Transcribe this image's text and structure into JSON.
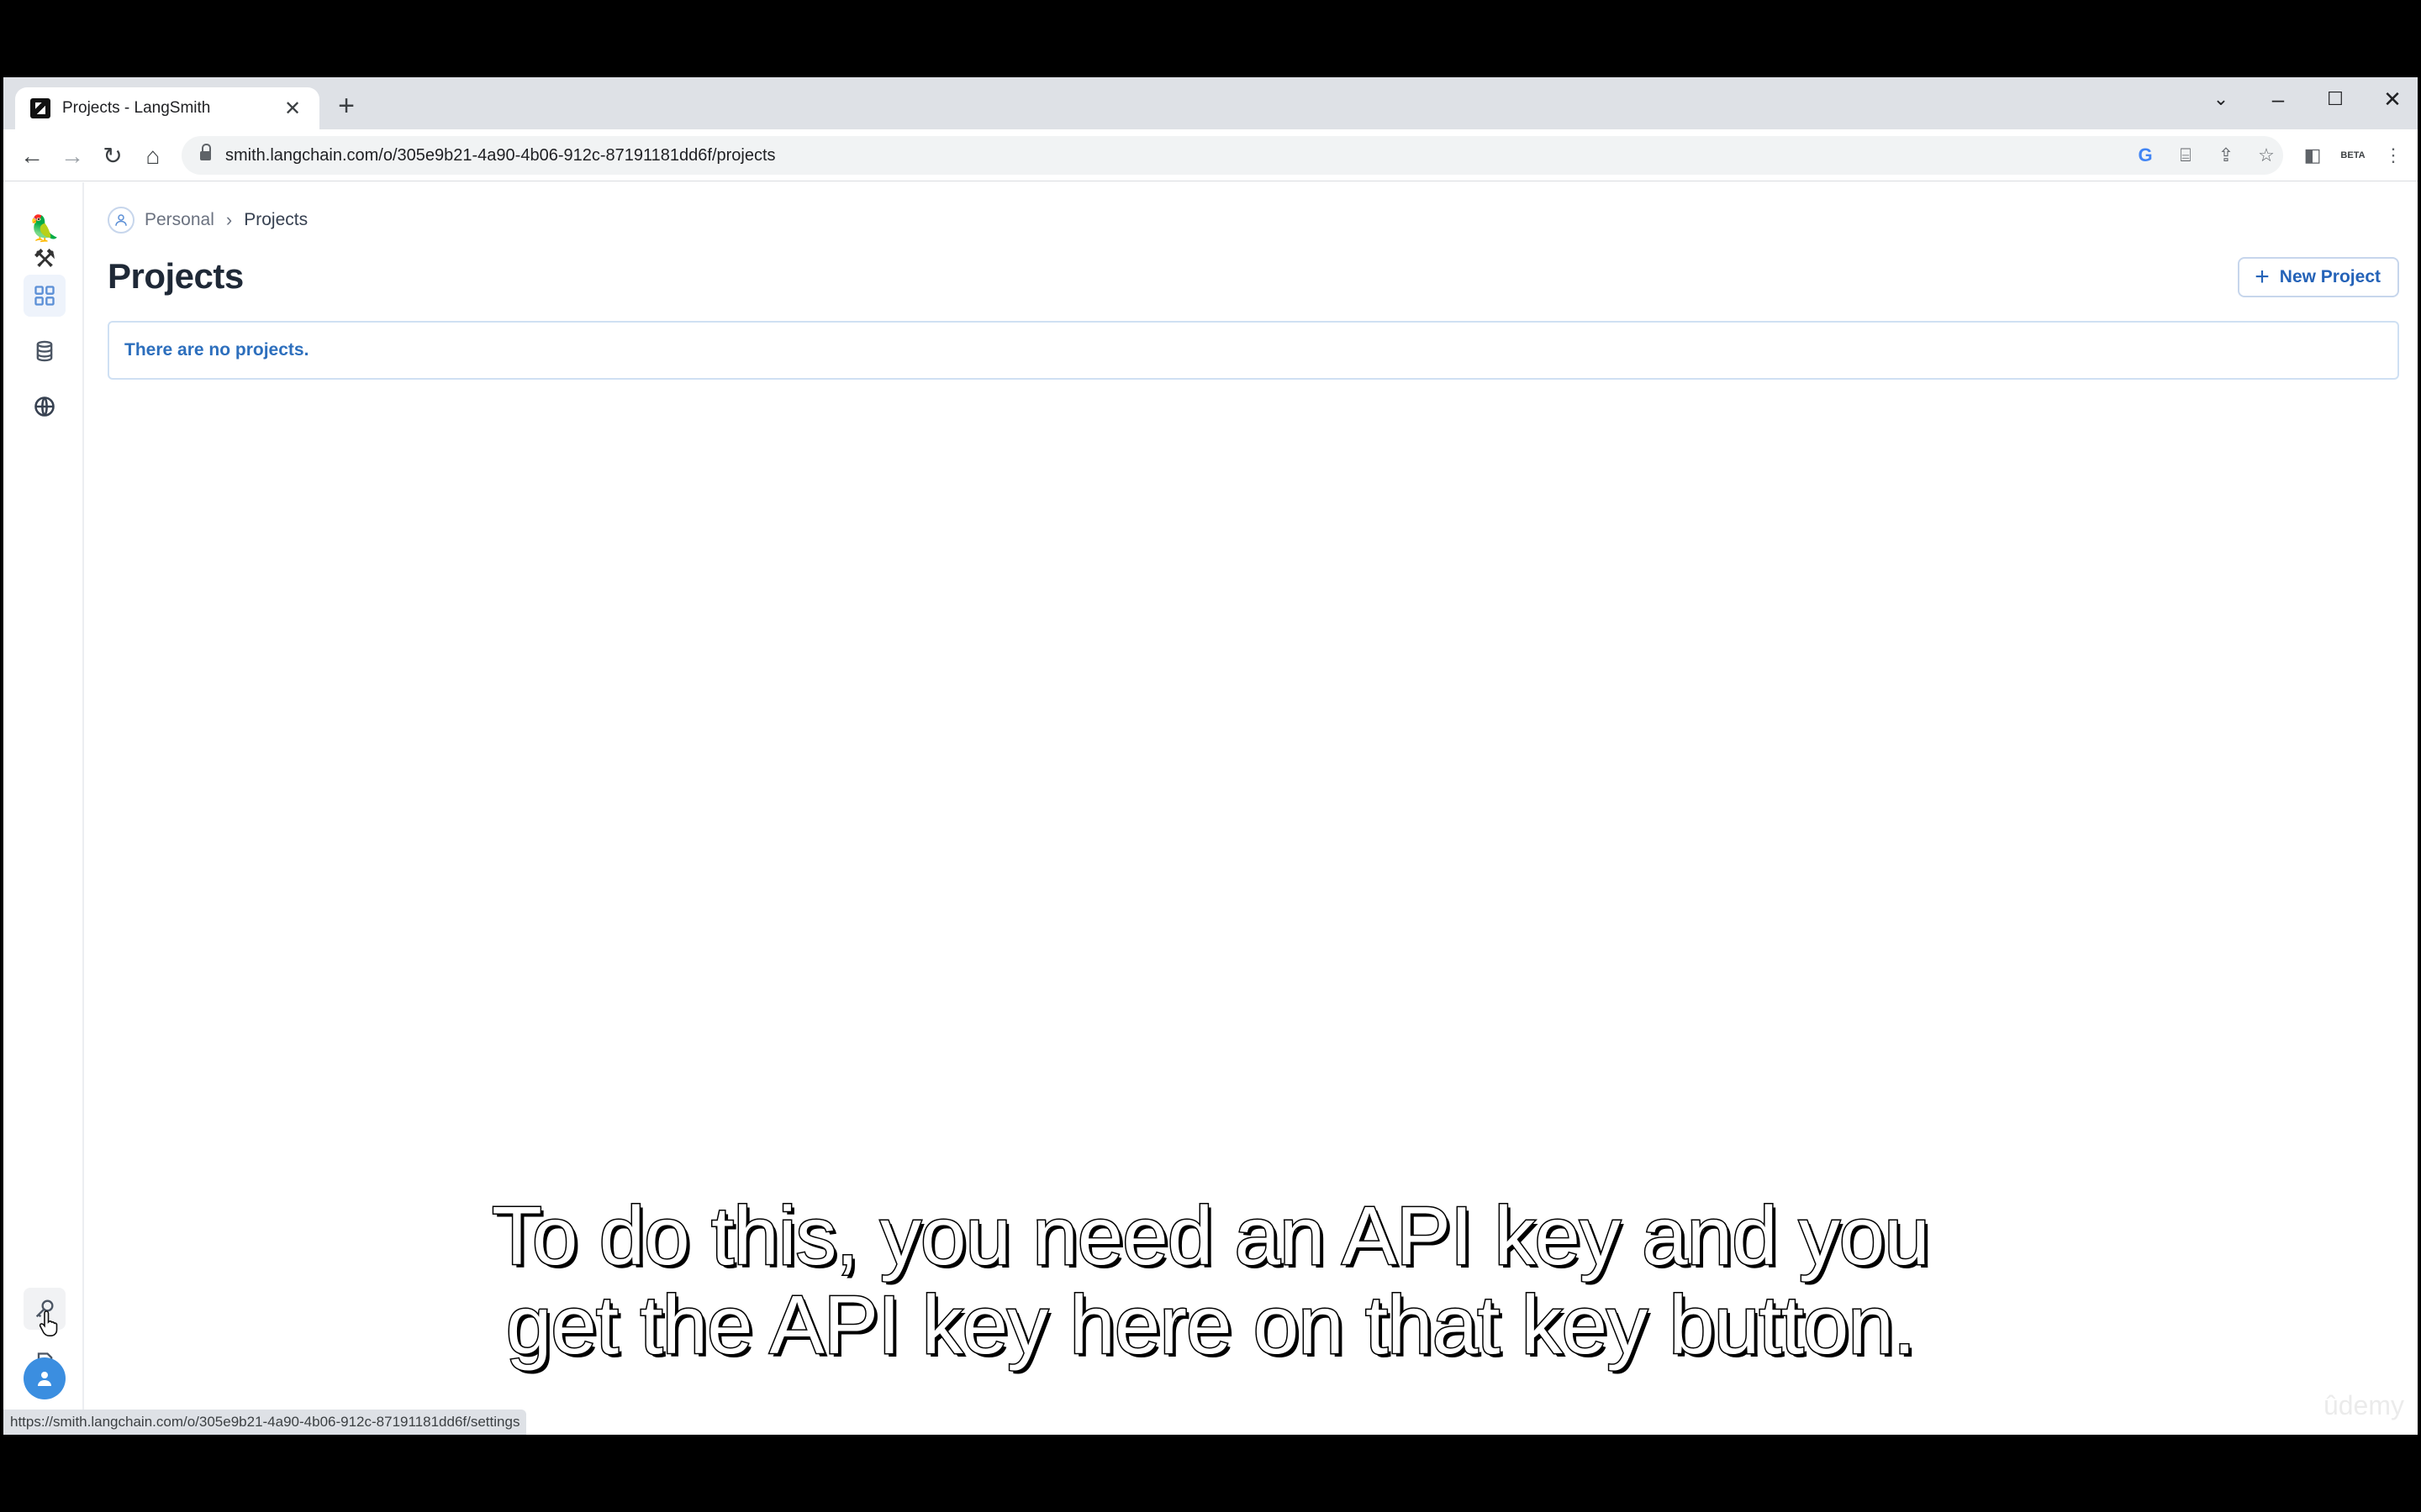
{
  "browser": {
    "tab_title": "Projects - LangSmith",
    "tab_close": "✕",
    "new_tab": "+",
    "url": "smith.langchain.com/o/305e9b21-4a90-4b06-912c-87191181dd6f/projects",
    "status_url": "https://smith.langchain.com/o/305e9b21-4a90-4b06-912c-87191181dd6f/settings",
    "extension_label": "BETA"
  },
  "breadcrumb": {
    "personal": "Personal",
    "separator": "›",
    "current": "Projects"
  },
  "page": {
    "title": "Projects",
    "new_project_label": "New Project",
    "empty_message": "There are no projects."
  },
  "sidebar": {
    "logo": "🦜⚒",
    "items": [
      "projects-grid",
      "datasets",
      "hub"
    ],
    "bottom_items": [
      "api-keys",
      "docs"
    ],
    "avatar_icon": "user"
  },
  "subtitle": {
    "line1": "To do this, you need an API key and you",
    "line2": "get the API key here on that key button."
  },
  "watermark": "ûdemy",
  "colors": {
    "accent": "#2563b8",
    "avatar": "#3b8ee0",
    "border": "#cfe0f3"
  }
}
